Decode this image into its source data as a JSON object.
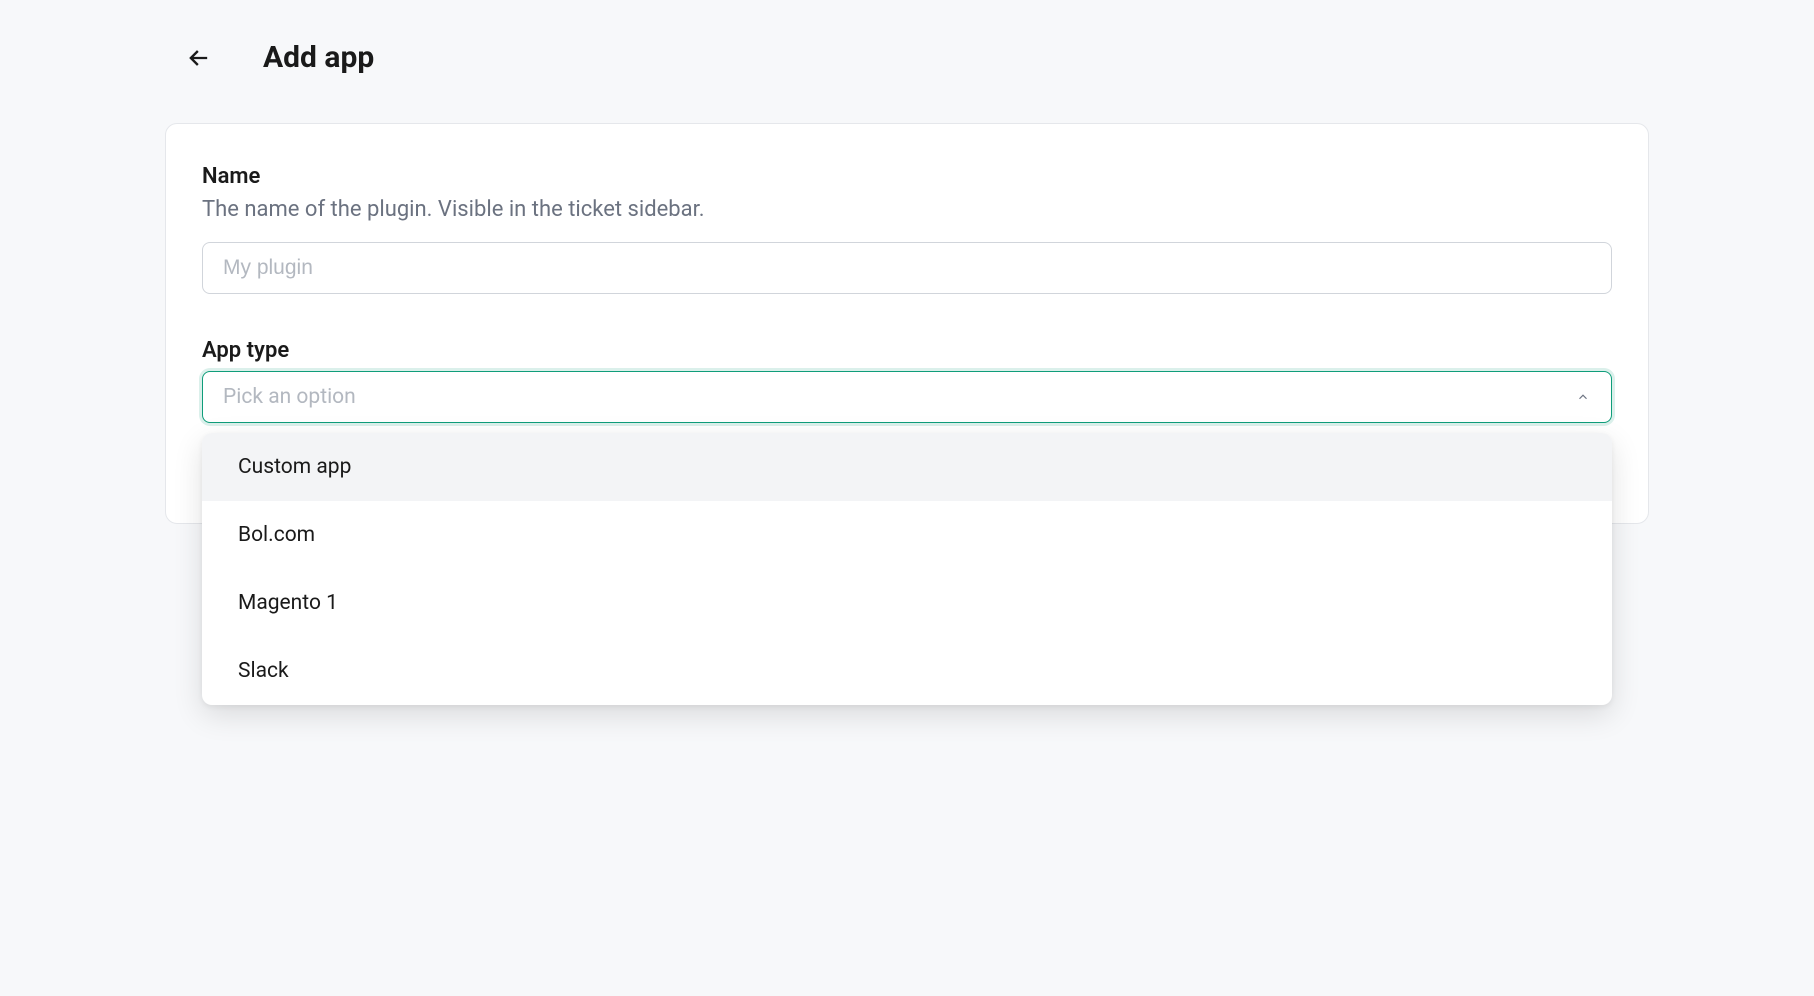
{
  "header": {
    "title": "Add app",
    "back_icon": "arrow-left"
  },
  "form": {
    "name_field": {
      "label": "Name",
      "helper": "The name of the plugin. Visible in the ticket sidebar.",
      "placeholder": "My plugin",
      "value": ""
    },
    "app_type_field": {
      "label": "App type",
      "placeholder": "Pick an option",
      "options": [
        "Custom app",
        "Bol.com",
        "Magento 1",
        "Slack"
      ],
      "highlighted_index": 0
    }
  }
}
